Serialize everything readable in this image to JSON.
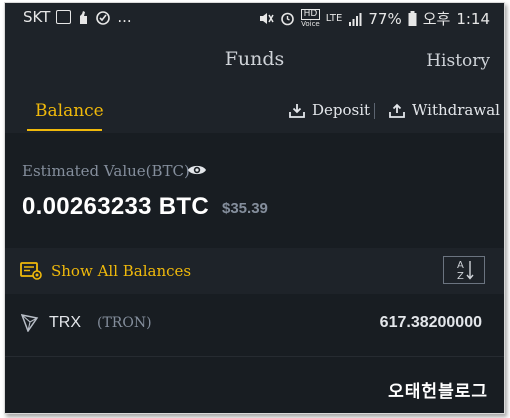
{
  "status_bar": {
    "carrier": "SKT",
    "dots": "...",
    "hd": "HD",
    "voice": "Voice",
    "network": "LTE",
    "battery": "77%",
    "ampm": "오후",
    "time": "1:14"
  },
  "header": {
    "title": "Funds",
    "history": "History"
  },
  "tabs": {
    "balance": "Balance",
    "deposit": "Deposit",
    "withdrawal": "Withdrawal"
  },
  "estimate": {
    "label": "Estimated Value(BTC)",
    "btc_value": "0.00263233 BTC",
    "usd_value": "$35.39"
  },
  "balances": {
    "show_all_label": "Show All Balances",
    "sort_icon": "a-z-sort-icon"
  },
  "assets": [
    {
      "symbol": "TRX",
      "name": "(TRON)",
      "amount": "617.38200000",
      "icon": "tron-icon"
    }
  ],
  "watermark": "오태헌블로그",
  "colors": {
    "accent": "#f0b90b",
    "background": "#1e2329",
    "panel": "#181d22",
    "muted_text": "#848e9c"
  }
}
